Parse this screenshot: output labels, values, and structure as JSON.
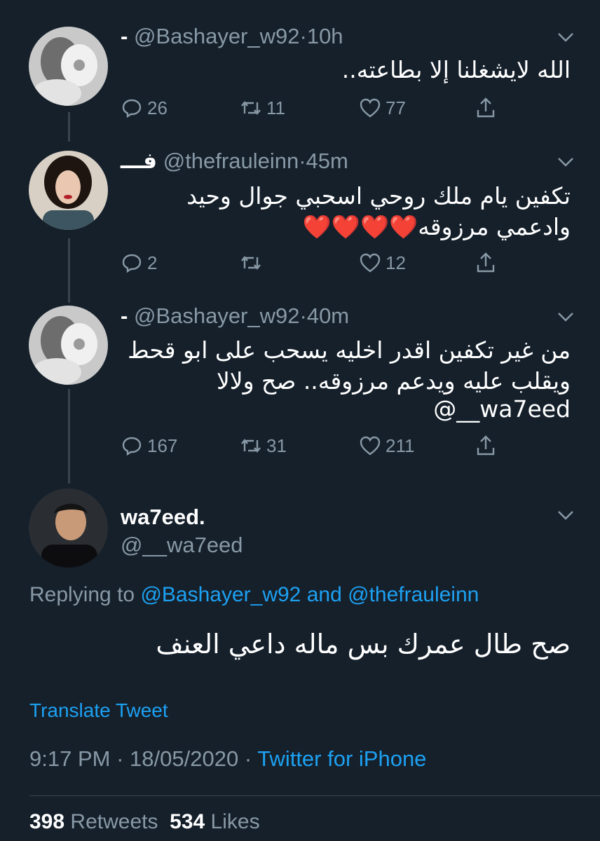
{
  "colors": {
    "background": "#15202b",
    "muted": "#8899a6",
    "accent": "#1da1f2",
    "like": "#e0245e"
  },
  "thread": [
    {
      "name": "-",
      "handle": "@Bashayer_w92",
      "separator": "·",
      "time": "10h",
      "text": "الله لايشغلنا إلا بطاعته..",
      "replies": "26",
      "retweets": "11",
      "likes": "77"
    },
    {
      "name": "فـــ",
      "handle": "@thefrauleinn",
      "separator": "·",
      "time": "45m",
      "text": "تكفين يام ملك روحي اسحبي جوال وحيد وادعمي مرزوقه❤️❤️❤️❤️",
      "replies": "2",
      "retweets": "",
      "likes": "12"
    },
    {
      "name": "-",
      "handle": "@Bashayer_w92",
      "separator": "·",
      "time": "40m",
      "text": "من غير تكفين اقدر اخليه يسحب على ابو قحط ويقلب عليه ويدعم مرزوقه.. صح ولالا",
      "mention": "@__wa7eed",
      "replies": "167",
      "retweets": "31",
      "likes": "211"
    }
  ],
  "main_tweet": {
    "name": "wa7eed.",
    "handle": "@__wa7eed",
    "replying_prefix": "Replying to",
    "reply_to_1": "@Bashayer_w92",
    "and_word": "and",
    "reply_to_2": "@thefrauleinn",
    "text": "صح طال عمرك بس ماله داعي العنف",
    "translate_label": "Translate Tweet",
    "time": "9:17 PM",
    "dot": "·",
    "date": "18/05/2020",
    "source": "Twitter for iPhone",
    "retweets_count": "398",
    "retweets_label": "Retweets",
    "likes_count": "534",
    "likes_label": "Likes"
  },
  "icons": [
    "reply-icon",
    "retweet-icon",
    "like-icon",
    "share-icon",
    "chevron-down-icon"
  ]
}
